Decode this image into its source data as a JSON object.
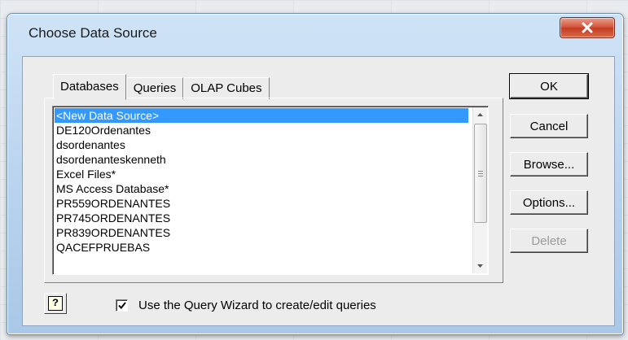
{
  "window": {
    "title": "Choose Data Source"
  },
  "tabs": [
    {
      "label": "Databases",
      "active": true
    },
    {
      "label": "Queries",
      "active": false
    },
    {
      "label": "OLAP Cubes",
      "active": false
    }
  ],
  "data_sources": [
    {
      "label": "<New Data Source>",
      "selected": true
    },
    {
      "label": "DE120Ordenantes",
      "selected": false
    },
    {
      "label": "dsordenantes",
      "selected": false
    },
    {
      "label": "dsordenanteskenneth",
      "selected": false
    },
    {
      "label": "Excel Files*",
      "selected": false
    },
    {
      "label": "MS Access Database*",
      "selected": false
    },
    {
      "label": "PR559ORDENANTES",
      "selected": false
    },
    {
      "label": "PR745ORDENANTES",
      "selected": false
    },
    {
      "label": "PR839ORDENANTES",
      "selected": false
    },
    {
      "label": "QACEFPRUEBAS",
      "selected": false
    }
  ],
  "buttons": {
    "ok": "OK",
    "cancel": "Cancel",
    "browse": "Browse...",
    "options": "Options...",
    "delete": "Delete"
  },
  "help_button": {
    "glyph": "?"
  },
  "query_wizard": {
    "label": "Use the Query Wizard to create/edit queries",
    "checked": true
  },
  "colors": {
    "selection": "#3399ff",
    "close_button": "#c33d23"
  }
}
